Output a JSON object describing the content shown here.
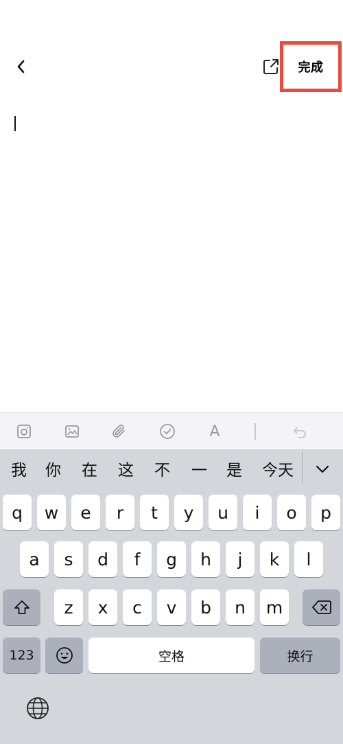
{
  "header": {
    "back_icon": "chevron-left-icon",
    "share_icon": "share-external-icon",
    "done_label": "完成"
  },
  "format_toolbar": {
    "icons": [
      "camera-icon",
      "image-icon",
      "paperclip-icon",
      "checklist-icon",
      "text-format-icon",
      "undo-icon"
    ],
    "text_format_label": "A"
  },
  "keyboard": {
    "candidates": [
      "我",
      "你",
      "在",
      "这",
      "不",
      "一",
      "是",
      "今天"
    ],
    "row1": [
      "q",
      "w",
      "e",
      "r",
      "t",
      "y",
      "u",
      "i",
      "o",
      "p"
    ],
    "row2": [
      "a",
      "s",
      "d",
      "f",
      "g",
      "h",
      "j",
      "k",
      "l"
    ],
    "row3": [
      "z",
      "x",
      "c",
      "v",
      "b",
      "n",
      "m"
    ],
    "numbers_label": "123",
    "space_label": "空格",
    "return_label": "换行",
    "emoji_icon": "emoji-icon",
    "globe_icon": "globe-icon",
    "shift_icon": "shift-icon",
    "delete_icon": "delete-icon"
  },
  "colors": {
    "highlight": "#e74c3c",
    "keyboard_bg": "#d4d6db",
    "dark_key": "#acb0ba"
  }
}
